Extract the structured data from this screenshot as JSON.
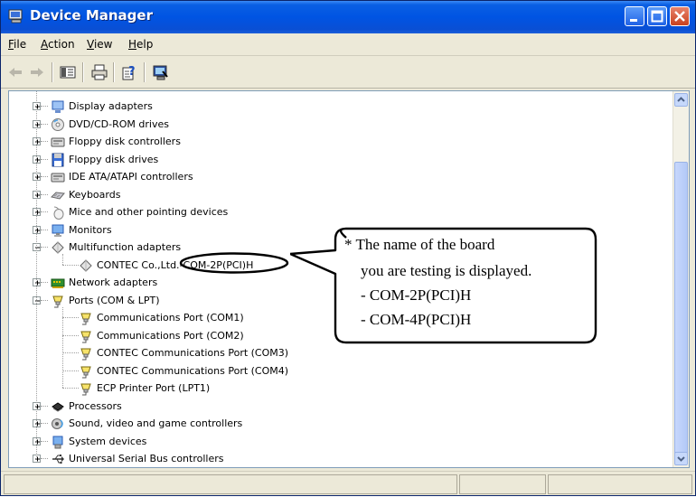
{
  "window": {
    "title": "Device Manager"
  },
  "menu": [
    {
      "key": "F",
      "rest": "ile"
    },
    {
      "key": "A",
      "rest": "ction"
    },
    {
      "key": "V",
      "rest": "iew"
    },
    {
      "key": "H",
      "rest": "elp"
    }
  ],
  "tree": [
    {
      "label": "Display adapters",
      "icon": "display-adapter-icon",
      "expander": "plus"
    },
    {
      "label": "DVD/CD-ROM drives",
      "icon": "cdrom-icon",
      "expander": "plus"
    },
    {
      "label": "Floppy disk controllers",
      "icon": "controller-icon",
      "expander": "plus"
    },
    {
      "label": "Floppy disk drives",
      "icon": "floppy-icon",
      "expander": "plus"
    },
    {
      "label": "IDE ATA/ATAPI controllers",
      "icon": "controller-icon",
      "expander": "plus"
    },
    {
      "label": "Keyboards",
      "icon": "keyboard-icon",
      "expander": "plus"
    },
    {
      "label": "Mice and other pointing devices",
      "icon": "mouse-icon",
      "expander": "plus"
    },
    {
      "label": "Monitors",
      "icon": "monitor-icon",
      "expander": "plus"
    },
    {
      "label": "Multifunction adapters",
      "icon": "multifunction-icon",
      "expander": "minus"
    },
    {
      "label": "CONTEC Co.,Ltd.-COM-2P(PCI)H",
      "icon": "multifunction-icon",
      "child": true
    },
    {
      "label": "Network adapters",
      "icon": "network-icon",
      "expander": "plus"
    },
    {
      "label": "Ports (COM & LPT)",
      "icon": "port-icon",
      "expander": "minus"
    },
    {
      "label": "Communications Port (COM1)",
      "icon": "port-icon",
      "child": true
    },
    {
      "label": "Communications Port (COM2)",
      "icon": "port-icon",
      "child": true
    },
    {
      "label": "CONTEC Communications Port (COM3)",
      "icon": "port-icon",
      "child": true
    },
    {
      "label": "CONTEC Communications Port (COM4)",
      "icon": "port-icon",
      "child": true
    },
    {
      "label": "ECP Printer Port (LPT1)",
      "icon": "port-icon",
      "child": true
    },
    {
      "label": "Processors",
      "icon": "processor-icon",
      "expander": "plus"
    },
    {
      "label": "Sound, video and game controllers",
      "icon": "sound-icon",
      "expander": "plus"
    },
    {
      "label": "System devices",
      "icon": "system-icon",
      "expander": "plus"
    },
    {
      "label": "Universal Serial Bus controllers",
      "icon": "usb-icon",
      "expander": "plus"
    }
  ],
  "callout": {
    "lines": [
      "* The name of the board",
      "you are testing is displayed.",
      "- COM-2P(PCI)H",
      "- COM-4P(PCI)H"
    ]
  },
  "colors": {
    "titlebar": "#0054e3",
    "face": "#ece9d8",
    "border": "#7f9db9"
  }
}
